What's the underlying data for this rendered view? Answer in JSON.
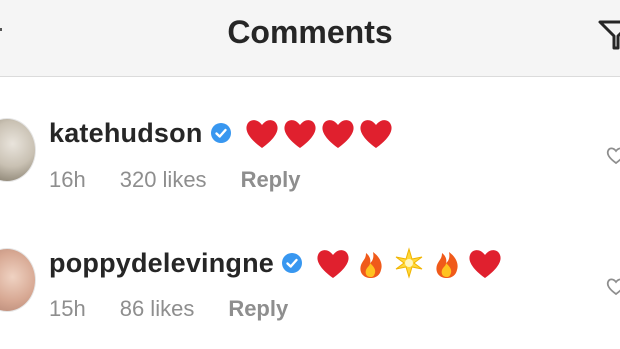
{
  "header": {
    "title": "Comments"
  },
  "comments": [
    {
      "username": "katehudson",
      "verified": true,
      "emojis": [
        "heart",
        "heart",
        "heart",
        "heart"
      ],
      "time": "16h",
      "likes": "320 likes",
      "reply": "Reply"
    },
    {
      "username": "poppydelevingne",
      "verified": true,
      "emojis": [
        "heart",
        "fire",
        "sparkle",
        "fire",
        "heart"
      ],
      "time": "15h",
      "likes": "86 likes",
      "reply": "Reply"
    }
  ],
  "colors": {
    "heart": "#e0202e",
    "verified": "#3897f0",
    "fire": "#f05a1a",
    "muted": "#8e8e8e"
  }
}
